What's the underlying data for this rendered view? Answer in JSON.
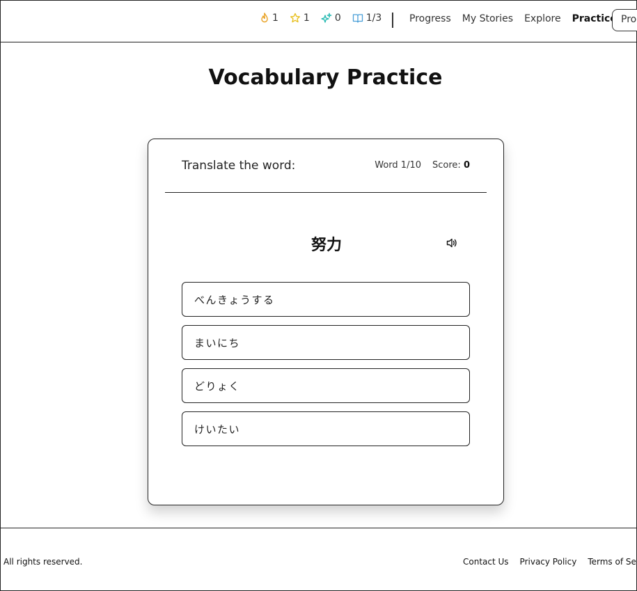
{
  "header": {
    "stats": [
      {
        "icon": "flame-icon",
        "value": "1",
        "color": "#e8a020"
      },
      {
        "icon": "star-icon",
        "value": "1",
        "color": "#e8c020"
      },
      {
        "icon": "sparkle-icon",
        "value": "0",
        "color": "#20b8b0"
      },
      {
        "icon": "book-icon",
        "value": "1/3",
        "color": "#4a9fd8"
      }
    ],
    "nav": [
      "Progress",
      "My Stories",
      "Explore",
      "Practice"
    ],
    "active_nav": "Practice",
    "profile_label": "Pro"
  },
  "page": {
    "title": "Vocabulary Practice"
  },
  "quiz": {
    "prompt": "Translate the word:",
    "word_counter": "Word 1/10",
    "score_label": "Score:",
    "score_value": "0",
    "target_word": "努力",
    "options": [
      "べんきょうする",
      "まいにち",
      "どりょく",
      "けいたい"
    ]
  },
  "footer": {
    "copyright": "All rights reserved.",
    "links": [
      "Contact Us",
      "Privacy Policy",
      "Terms of Servi"
    ]
  }
}
